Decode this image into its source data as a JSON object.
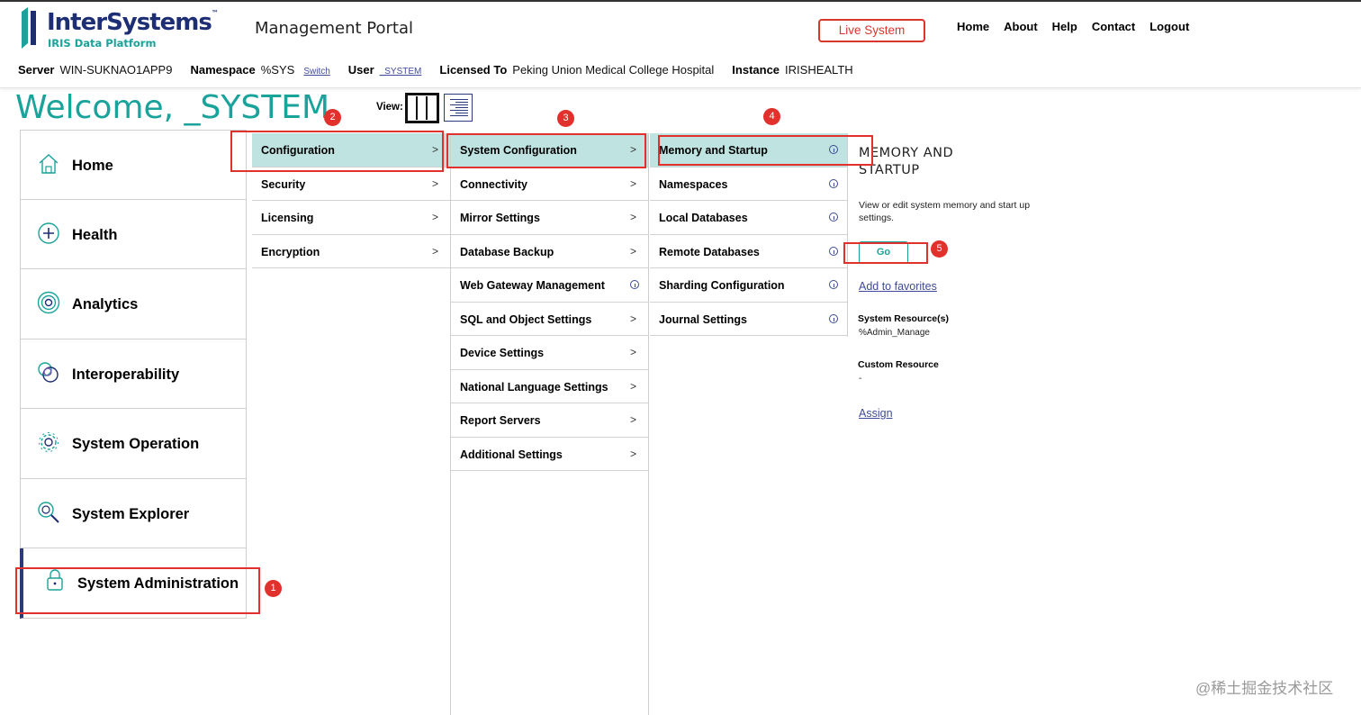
{
  "header": {
    "logo_name": "InterSystems",
    "logo_tm": "™",
    "logo_sub": "IRIS Data Platform",
    "portal_title": "Management Portal",
    "live_system": "Live System",
    "nav": [
      "Home",
      "About",
      "Help",
      "Contact",
      "Logout"
    ]
  },
  "info": {
    "server_label": "Server",
    "server": "WIN-SUKNAO1APP9",
    "namespace_label": "Namespace",
    "namespace": "%SYS",
    "switch": "Switch",
    "user_label": "User",
    "user": "_SYSTEM",
    "licensed_label": "Licensed To",
    "licensed": "Peking Union Medical College Hospital",
    "instance_label": "Instance",
    "instance": "IRISHEALTH"
  },
  "welcome": "Welcome, _SYSTEM",
  "view_label": "View:",
  "main_menu": [
    {
      "label": "Home",
      "icon": "home-icon"
    },
    {
      "label": "Health",
      "icon": "health-icon"
    },
    {
      "label": "Analytics",
      "icon": "analytics-icon"
    },
    {
      "label": "Interoperability",
      "icon": "interoperability-icon"
    },
    {
      "label": "System Operation",
      "icon": "gear-icon"
    },
    {
      "label": "System Explorer",
      "icon": "magnifier-icon"
    },
    {
      "label": "System Administration",
      "icon": "lock-icon"
    }
  ],
  "col1": [
    "Configuration",
    "Security",
    "Licensing",
    "Encryption"
  ],
  "col2": [
    "System Configuration",
    "Connectivity",
    "Mirror Settings",
    "Database Backup",
    "Web Gateway Management",
    "SQL and Object Settings",
    "Device Settings",
    "National Language Settings",
    "Report Servers",
    "Additional Settings"
  ],
  "col3": [
    "Memory and Startup",
    "Namespaces",
    "Local Databases",
    "Remote Databases",
    "Sharding Configuration",
    "Journal Settings"
  ],
  "detail": {
    "title": "MEMORY AND STARTUP",
    "description": "View or edit system memory and start up settings.",
    "go": "Go",
    "favorites": "Add to favorites",
    "system_resource_label": "System Resource(s)",
    "system_resource": "%Admin_Manage",
    "custom_resource_label": "Custom Resource",
    "custom_resource": "-",
    "assign": "Assign"
  },
  "annotations": [
    "1",
    "2",
    "3",
    "4",
    "5"
  ],
  "watermark": "@稀土掘金技术社区",
  "colors": {
    "brand_navy": "#1d2e74",
    "teal": "#1aa39a",
    "selected_row": "#bfe3e1",
    "alert_red": "#d9362f",
    "annotation_red": "#e2302c"
  }
}
